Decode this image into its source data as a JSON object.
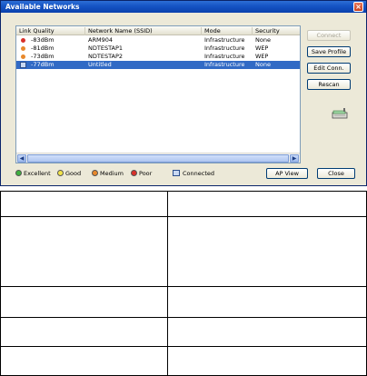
{
  "window": {
    "title": "Available Networks",
    "close_glyph": "×"
  },
  "list": {
    "columns": [
      "Link Quality",
      "Network Name (SSID)",
      "Mode",
      "Security"
    ],
    "rows": [
      {
        "quality": "-83dBm",
        "ssid": "ARM904",
        "mode": "Infrastructure",
        "security": "None",
        "level": "poor",
        "selected": false
      },
      {
        "quality": "-81dBm",
        "ssid": "NDTESTAP1",
        "mode": "Infrastructure",
        "security": "WEP",
        "level": "medium",
        "selected": false
      },
      {
        "quality": "-73dBm",
        "ssid": "NDTESTAP2",
        "mode": "Infrastructure",
        "security": "WEP",
        "level": "medium",
        "selected": false
      },
      {
        "quality": "-77dBm",
        "ssid": "Untitled",
        "mode": "Infrastructure",
        "security": "None",
        "level": "connected",
        "selected": true
      }
    ]
  },
  "buttons": {
    "connect": "Connect",
    "save_profile": "Save Profile",
    "edit_conn": "Edit Conn.",
    "rescan": "Rescan",
    "ap_view": "AP View",
    "close": "Close"
  },
  "legend": {
    "excellent": "Excellent",
    "good": "Good",
    "medium": "Medium",
    "poor": "Poor",
    "connected": "Connected"
  },
  "colors": {
    "excellent": "#3fb13f",
    "good": "#f2e34a",
    "medium": "#e8892c",
    "poor": "#d9312a",
    "selection": "#316ac5"
  }
}
